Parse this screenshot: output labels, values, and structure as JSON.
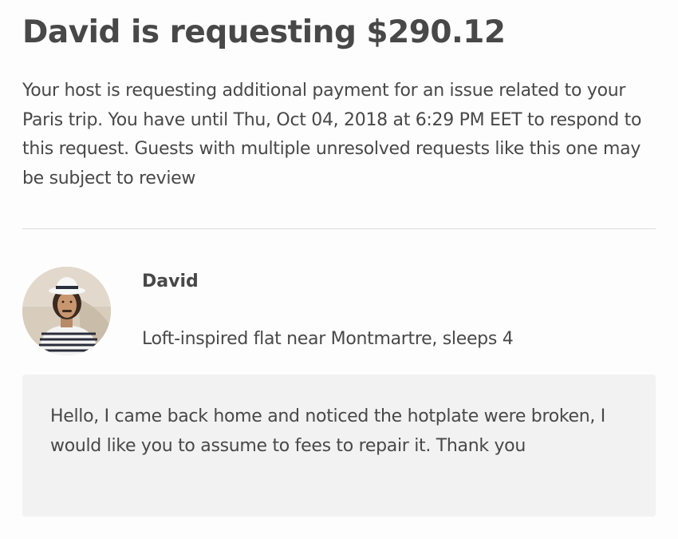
{
  "request": {
    "title": "David is requesting $290.12",
    "description": "Your host is requesting additional payment for an issue related to your Paris trip. You have until Thu, Oct 04, 2018 at 6:29 PM EET to respond to this request. Guests with multiple unresolved requests like this one may be subject to review"
  },
  "host": {
    "avatar_icon": "host-avatar-photo",
    "name": "David",
    "listing": "Loft-inspired flat near Montmartre, sleeps 4"
  },
  "message": {
    "text": "Hello, I came back home and noticed the hotplate were broken, I would like you to assume to fees to repair it. Thank you"
  },
  "colors": {
    "text": "#484848",
    "divider": "#dcdcdc",
    "message_background": "#f2f2f2"
  }
}
